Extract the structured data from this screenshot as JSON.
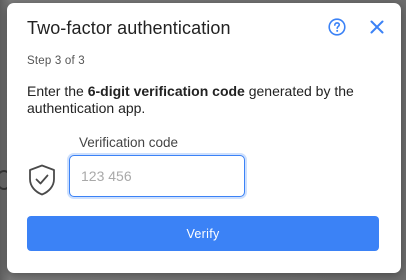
{
  "dialog": {
    "title": "Two-factor authentication",
    "step": "Step 3 of 3",
    "instructions": {
      "prefix": "Enter the ",
      "emphasis": "6-digit verification code",
      "suffix": " generated by the authentication app."
    },
    "field": {
      "label": "Verification code",
      "value": "",
      "placeholder": "123 456"
    },
    "verify_label": "Verify",
    "icons": {
      "help": "help-circle-icon",
      "close": "close-icon",
      "shield": "shield-check-icon"
    }
  },
  "colors": {
    "accent": "#3b82f6",
    "overlay": "#6f6f6f",
    "dialog_bg": "#ffffff"
  }
}
